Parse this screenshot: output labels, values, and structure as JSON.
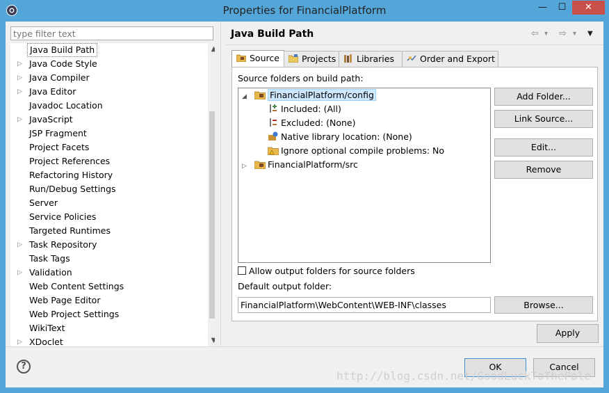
{
  "window": {
    "title": "Properties for FinancialPlatform",
    "minimize_glyph": "—",
    "maximize_glyph": "☐",
    "close_glyph": "✕"
  },
  "filter": {
    "placeholder": "type filter text"
  },
  "sidebar": {
    "items": [
      {
        "label": "Java Build Path",
        "expandable": false,
        "selected": true
      },
      {
        "label": "Java Code Style",
        "expandable": true
      },
      {
        "label": "Java Compiler",
        "expandable": true
      },
      {
        "label": "Java Editor",
        "expandable": true
      },
      {
        "label": "Javadoc Location",
        "expandable": false
      },
      {
        "label": "JavaScript",
        "expandable": true
      },
      {
        "label": "JSP Fragment",
        "expandable": false
      },
      {
        "label": "Project Facets",
        "expandable": false
      },
      {
        "label": "Project References",
        "expandable": false
      },
      {
        "label": "Refactoring History",
        "expandable": false
      },
      {
        "label": "Run/Debug Settings",
        "expandable": false
      },
      {
        "label": "Server",
        "expandable": false
      },
      {
        "label": "Service Policies",
        "expandable": false
      },
      {
        "label": "Targeted Runtimes",
        "expandable": false
      },
      {
        "label": "Task Repository",
        "expandable": true
      },
      {
        "label": "Task Tags",
        "expandable": false
      },
      {
        "label": "Validation",
        "expandable": true
      },
      {
        "label": "Web Content Settings",
        "expandable": false
      },
      {
        "label": "Web Page Editor",
        "expandable": false
      },
      {
        "label": "Web Project Settings",
        "expandable": false
      },
      {
        "label": "WikiText",
        "expandable": false
      },
      {
        "label": "XDoclet",
        "expandable": true
      }
    ]
  },
  "page": {
    "title": "Java Build Path",
    "nav": {
      "back": "⇦",
      "forward": "⇨",
      "dropdown": "▾",
      "menu": "▼"
    }
  },
  "tabs": [
    {
      "label": "Source",
      "active": true,
      "icon": "source-folder-icon"
    },
    {
      "label": "Projects",
      "active": false,
      "icon": "projects-icon"
    },
    {
      "label": "Libraries",
      "active": false,
      "icon": "libraries-icon"
    },
    {
      "label": "Order and Export",
      "active": false,
      "icon": "order-export-icon"
    }
  ],
  "source": {
    "heading": "Source folders on build path:",
    "tree": [
      {
        "label": "FinancialPlatform/config",
        "expanded": true,
        "selected": true
      },
      {
        "label": "Included: (All)"
      },
      {
        "label": "Excluded: (None)"
      },
      {
        "label": "Native library location: (None)"
      },
      {
        "label": "Ignore optional compile problems: No"
      },
      {
        "label": "FinancialPlatform/src",
        "expanded": false
      }
    ],
    "buttons": {
      "add_folder": "Add Folder...",
      "link_source": "Link Source...",
      "edit": "Edit...",
      "remove": "Remove"
    },
    "allow_output_label": "Allow output folders for source folders",
    "allow_output_checked": false,
    "default_output_label": "Default output folder:",
    "default_output_value": "FinancialPlatform\\WebContent\\WEB-INF\\classes",
    "browse": "Browse..."
  },
  "footer": {
    "apply": "Apply",
    "ok": "OK",
    "cancel": "Cancel",
    "help": "?"
  },
  "watermark": "http://blog.csdn.net/GoodLuckToThePole",
  "colors": {
    "titlebar": "#54a6d8",
    "close": "#c7514a",
    "selection": "#cde8ff"
  }
}
